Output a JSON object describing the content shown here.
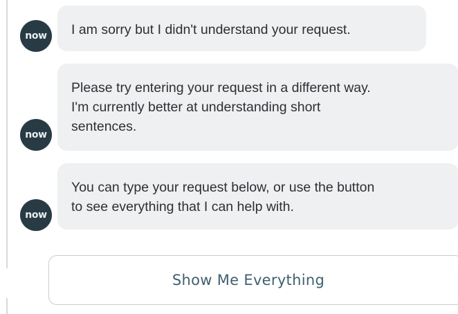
{
  "avatar": {
    "logo_text": "now"
  },
  "messages": [
    {
      "text": "I am sorry but I didn't understand your request."
    },
    {
      "text": "Please try entering your request in a different way.\nI'm currently better at understanding short\nsentences."
    },
    {
      "text": "You can type your request below, or use the button\nto see everything that I can help with."
    }
  ],
  "action_button": {
    "label": "Show Me Everything"
  },
  "colors": {
    "avatar_bg": "#283b45",
    "bubble_bg": "#eef0f2",
    "button_text": "#3f6070"
  }
}
